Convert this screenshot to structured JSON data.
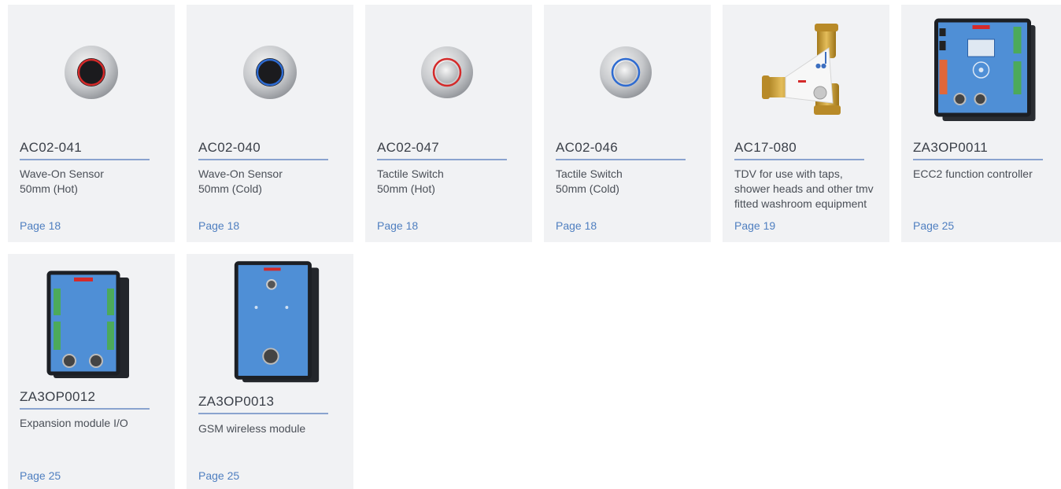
{
  "products": [
    {
      "code": "AC02-041",
      "description_lines": [
        "Wave-On Sensor",
        "50mm (Hot)"
      ],
      "page": "Page 18",
      "icon": "wave-on-sensor-hot-icon",
      "ring_color": "#d42a2a"
    },
    {
      "code": "AC02-040",
      "description_lines": [
        "Wave-On Sensor",
        "50mm (Cold)"
      ],
      "page": "Page 18",
      "icon": "wave-on-sensor-cold-icon",
      "ring_color": "#2e6bd1"
    },
    {
      "code": "AC02-047",
      "description_lines": [
        "Tactile Switch",
        "50mm (Hot)"
      ],
      "page": "Page 18",
      "icon": "tactile-switch-hot-icon",
      "ring_color": "#d42a2a"
    },
    {
      "code": "AC02-046",
      "description_lines": [
        "Tactile Switch",
        "50mm (Cold)"
      ],
      "page": "Page 18",
      "icon": "tactile-switch-cold-icon",
      "ring_color": "#2e6bd1"
    },
    {
      "code": "AC17-080",
      "description_lines": [
        "TDV for use with taps,",
        "shower heads and other tmv",
        "fitted washroom equipment"
      ],
      "page": "Page 19",
      "icon": "thermal-disinfection-valve-icon"
    },
    {
      "code": "ZA3OP0011",
      "description_lines": [
        "ECC2 function controller"
      ],
      "page": "Page 25",
      "icon": "ecc2-controller-icon"
    },
    {
      "code": "ZA3OP0012",
      "description_lines": [
        "Expansion module I/O"
      ],
      "page": "Page 25",
      "icon": "expansion-module-icon"
    },
    {
      "code": "ZA3OP0013",
      "description_lines": [
        "GSM wireless module"
      ],
      "page": "Page 25",
      "icon": "gsm-module-icon"
    }
  ],
  "colors": {
    "card_bg": "#f1f2f4",
    "rule": "#8aa3cf",
    "page_link": "#4f7fc0",
    "device_blue": "#4f8fd6",
    "brass": "#c99a2e"
  }
}
